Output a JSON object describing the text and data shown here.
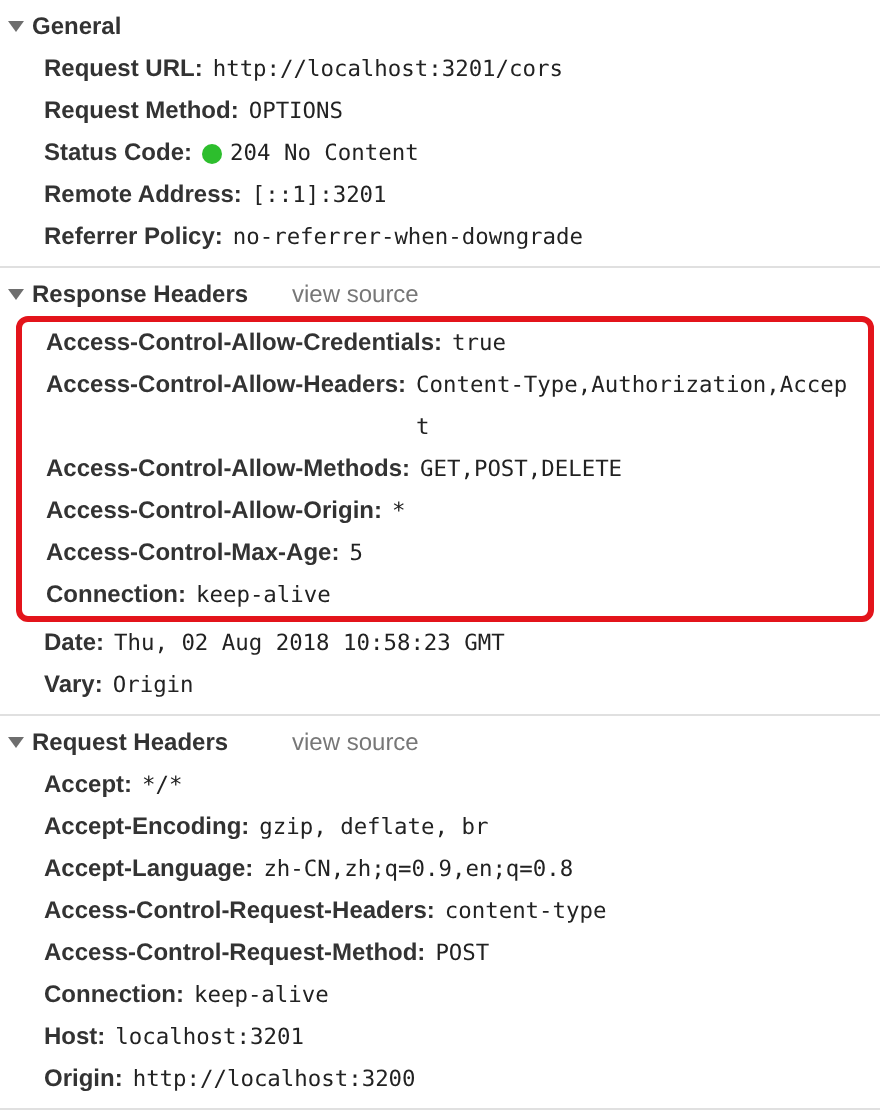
{
  "sections": [
    {
      "title": "General",
      "expanded": true,
      "rows": [
        {
          "name": "Request URL:",
          "value": "http://localhost:3201/cors",
          "highlighted": false
        },
        {
          "name": "Request Method:",
          "value": "OPTIONS",
          "highlighted": false
        },
        {
          "name": "Status Code:",
          "value": "204 No Content",
          "color": "#2dbe2d",
          "highlighted": false
        },
        {
          "name": "Remote Address:",
          "value": "[::1]:3201",
          "highlighted": false
        },
        {
          "name": "Referrer Policy:",
          "value": "no-referrer-when-downgrade",
          "highlighted": false
        }
      ]
    },
    {
      "title": "Response Headers",
      "link": "view source",
      "expanded": true,
      "rows": [
        {
          "name": "Access-Control-Allow-Credentials:",
          "value": "true",
          "highlighted": true
        },
        {
          "name": "Access-Control-Allow-Headers:",
          "value": "Content-Type,Authorization,Accept",
          "highlighted": true
        },
        {
          "name": "Access-Control-Allow-Methods:",
          "value": "GET,POST,DELETE",
          "highlighted": true
        },
        {
          "name": "Access-Control-Allow-Origin:",
          "value": "*",
          "highlighted": true
        },
        {
          "name": "Access-Control-Max-Age:",
          "value": "5",
          "highlighted": true
        },
        {
          "name": "Connection:",
          "value": "keep-alive",
          "highlighted": true
        },
        {
          "name": "Date:",
          "value": "Thu, 02 Aug 2018 10:58:23 GMT",
          "highlighted": false
        },
        {
          "name": "Vary:",
          "value": "Origin",
          "highlighted": false
        }
      ]
    },
    {
      "title": "Request Headers",
      "link": "view source",
      "expanded": true,
      "rows": [
        {
          "name": "Accept:",
          "value": "*/*",
          "highlighted": false
        },
        {
          "name": "Accept-Encoding:",
          "value": "gzip, deflate, br",
          "highlighted": false
        },
        {
          "name": "Accept-Language:",
          "value": "zh-CN,zh;q=0.9,en;q=0.8",
          "highlighted": false
        },
        {
          "name": "Access-Control-Request-Headers:",
          "value": "content-type",
          "highlighted": false
        },
        {
          "name": "Access-Control-Request-Method:",
          "value": "POST",
          "highlighted": false
        },
        {
          "name": "Connection:",
          "value": "keep-alive",
          "highlighted": false
        },
        {
          "name": "Host:",
          "value": "localhost:3201",
          "highlighted": false
        },
        {
          "name": "Origin:",
          "value": "http://localhost:3200",
          "highlighted": false
        }
      ]
    }
  ]
}
